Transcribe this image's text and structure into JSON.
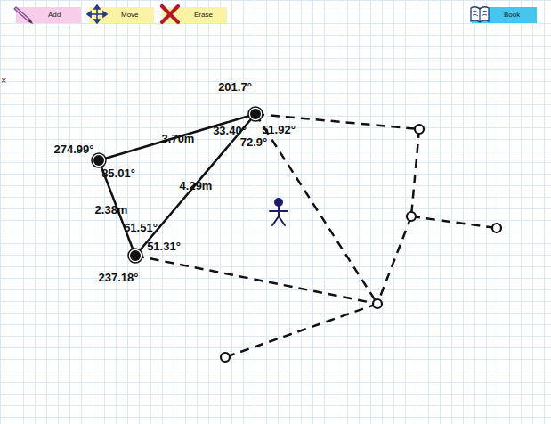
{
  "toolbar": [
    {
      "label": "Add"
    },
    {
      "label": "Move"
    },
    {
      "label": "Erase"
    },
    {
      "label": "Book"
    }
  ],
  "canvas": {
    "marker": "×",
    "points": [
      {
        "kind": "corner",
        "label": "201.7°"
      },
      {
        "kind": "corner",
        "label": "274.99°"
      },
      {
        "kind": "corner",
        "label": "237.18°"
      },
      {
        "kind": "node"
      },
      {
        "kind": "node"
      },
      {
        "kind": "node"
      },
      {
        "kind": "node"
      },
      {
        "kind": "node"
      }
    ],
    "edges": [
      {
        "kind": "solid",
        "length": "3.70m"
      },
      {
        "kind": "solid",
        "length": "4.29m"
      },
      {
        "kind": "solid",
        "length": "2.38m"
      },
      {
        "kind": "dashed"
      },
      {
        "kind": "dashed"
      },
      {
        "kind": "dashed"
      },
      {
        "kind": "dashed"
      },
      {
        "kind": "dashed"
      },
      {
        "kind": "dashed"
      },
      {
        "kind": "dashed"
      }
    ],
    "angles": [
      "33.40°",
      "51.92°",
      "72.9°",
      "85.01°",
      "61.51°",
      "51.31°"
    ]
  }
}
